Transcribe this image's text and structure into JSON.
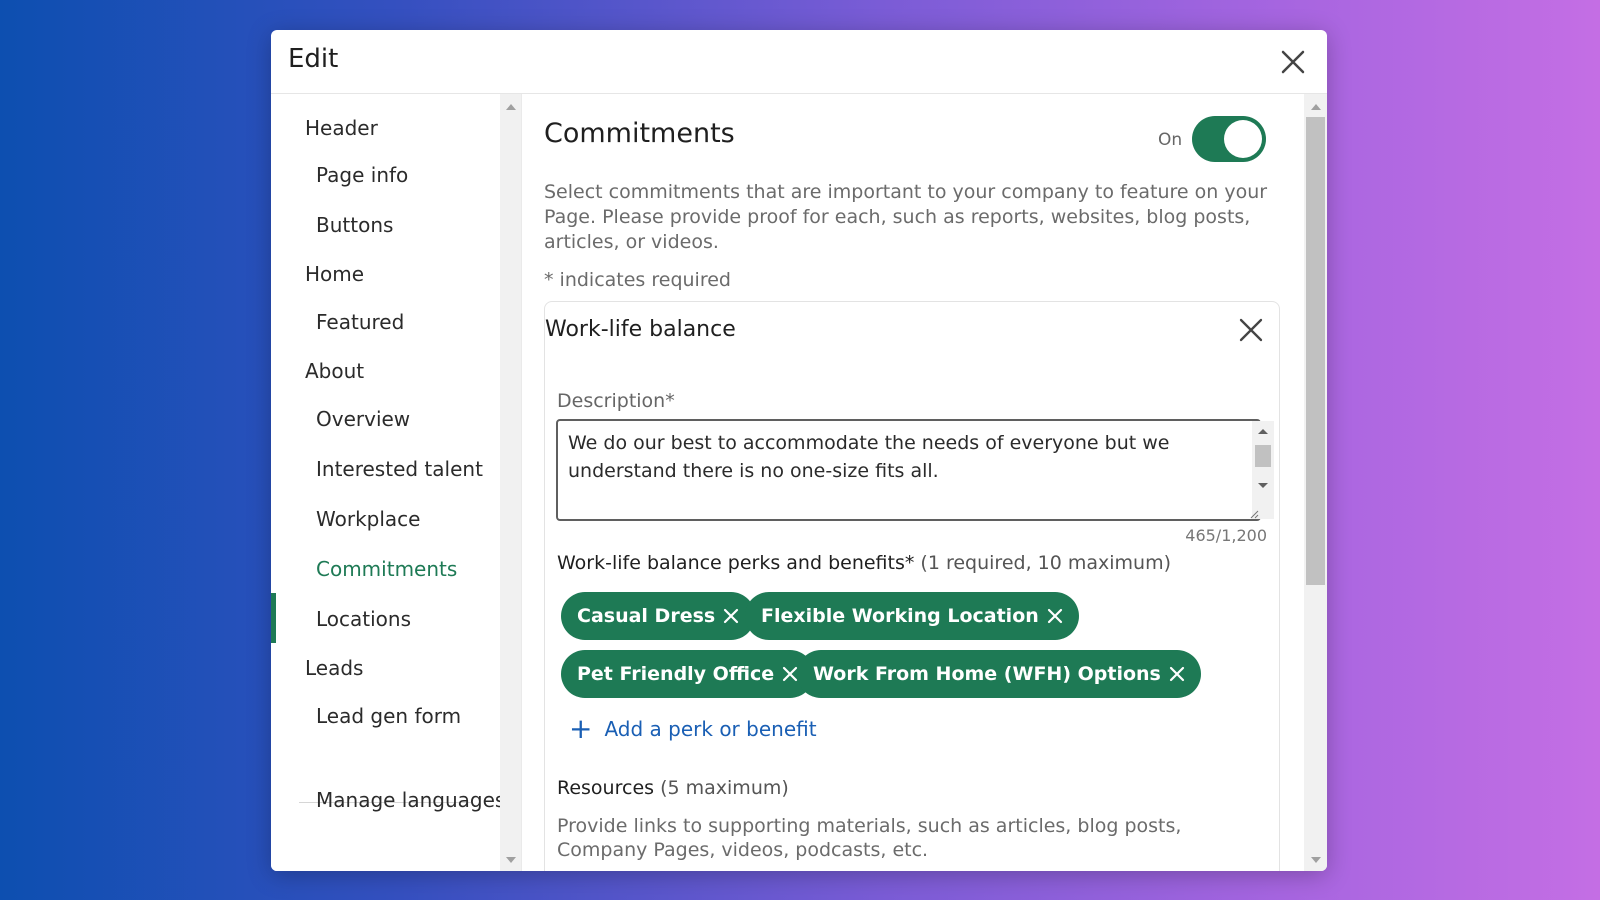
{
  "modal": {
    "title": "Edit"
  },
  "sidebar": {
    "items": [
      {
        "label": "Header",
        "level": "top"
      },
      {
        "label": "Page info",
        "level": "sub"
      },
      {
        "label": "Buttons",
        "level": "sub"
      },
      {
        "label": "Home",
        "level": "top"
      },
      {
        "label": "Featured",
        "level": "sub"
      },
      {
        "label": "About",
        "level": "top"
      },
      {
        "label": "Overview",
        "level": "sub"
      },
      {
        "label": "Interested talent",
        "level": "sub"
      },
      {
        "label": "Workplace",
        "level": "sub"
      },
      {
        "label": "Commitments",
        "level": "sub",
        "active": true
      },
      {
        "label": "Locations",
        "level": "sub"
      },
      {
        "label": "Leads",
        "level": "top"
      },
      {
        "label": "Lead gen form",
        "level": "sub"
      }
    ],
    "manage_languages": "Manage languages"
  },
  "main": {
    "section_title": "Commitments",
    "toggle_label": "On",
    "toggle_on": true,
    "intro": "Select commitments that are important to your company to feature on your Page. Please provide proof for each, such as reports, websites, blog posts, articles, or videos.",
    "required_note": "* indicates required",
    "card": {
      "title": "Work-life balance",
      "description_label": "Description*",
      "description_value": "We do our best to accommodate the needs of everyone but we understand there is no one-size fits all.",
      "char_count": "465/1,200",
      "perks_label": "Work-life balance perks and benefits*",
      "perks_hint": "(1 required, 10 maximum)",
      "perks": [
        "Casual Dress",
        "Flexible Working Location",
        "Pet Friendly Office",
        "Work From Home (WFH) Options"
      ],
      "add_perk": "Add a perk or benefit",
      "resources_label": "Resources",
      "resources_hint": "(5 maximum)",
      "resources_desc": "Provide links to supporting materials, such as articles, blog posts, Company Pages, videos, podcasts, etc."
    }
  },
  "colors": {
    "accent": "#1e7a55",
    "link": "#1a5fb4"
  }
}
